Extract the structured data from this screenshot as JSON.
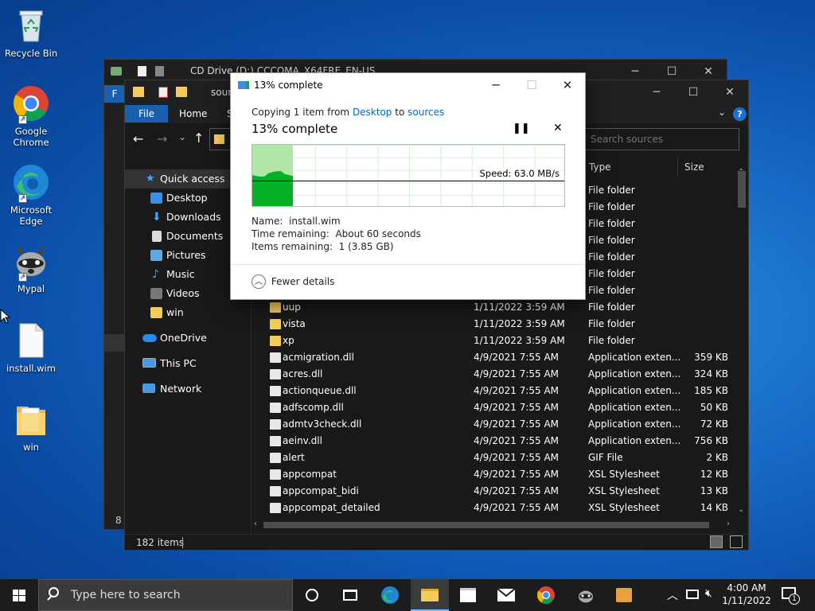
{
  "desktop": {
    "icons": [
      {
        "label": "Recycle Bin"
      },
      {
        "label": "Google Chrome"
      },
      {
        "label": "Microsoft Edge"
      },
      {
        "label": "Mypal"
      },
      {
        "label": "install.wim"
      },
      {
        "label": "win"
      }
    ]
  },
  "back_window": {
    "title": "CD Drive (D:) CCCOMA_X64FRE_EN-US_DV9",
    "status_fragment": "8 i",
    "ribbon_fragment": "F"
  },
  "explorer": {
    "path_fragment": "sour",
    "ribbon": {
      "file": "File",
      "home": "Home",
      "share_fragment": "S"
    },
    "search_placeholder": "Search sources",
    "columns": {
      "type": "Type",
      "size": "Size"
    },
    "nav": {
      "quick_access": "Quick access",
      "desktop": "Desktop",
      "downloads": "Downloads",
      "documents": "Documents",
      "pictures": "Pictures",
      "music": "Music",
      "videos": "Videos",
      "win": "win",
      "onedrive": "OneDrive",
      "thispc": "This PC",
      "network": "Network"
    },
    "partial_types": [
      "File folder",
      "File folder",
      "File folder",
      "File folder",
      "File folder",
      "File folder",
      "File folder"
    ],
    "files": [
      {
        "name": "uup",
        "date": "1/11/2022 3:59 AM",
        "type": "File folder",
        "size": "",
        "icon": "folder"
      },
      {
        "name": "vista",
        "date": "1/11/2022 3:59 AM",
        "type": "File folder",
        "size": "",
        "icon": "folder"
      },
      {
        "name": "xp",
        "date": "1/11/2022 3:59 AM",
        "type": "File folder",
        "size": "",
        "icon": "folder"
      },
      {
        "name": "acmigration.dll",
        "date": "4/9/2021 7:55 AM",
        "type": "Application exten...",
        "size": "359 KB",
        "icon": "dll"
      },
      {
        "name": "acres.dll",
        "date": "4/9/2021 7:55 AM",
        "type": "Application exten...",
        "size": "324 KB",
        "icon": "dll"
      },
      {
        "name": "actionqueue.dll",
        "date": "4/9/2021 7:55 AM",
        "type": "Application exten...",
        "size": "185 KB",
        "icon": "dll"
      },
      {
        "name": "adfscomp.dll",
        "date": "4/9/2021 7:55 AM",
        "type": "Application exten...",
        "size": "50 KB",
        "icon": "dll"
      },
      {
        "name": "admtv3check.dll",
        "date": "4/9/2021 7:55 AM",
        "type": "Application exten...",
        "size": "72 KB",
        "icon": "dll"
      },
      {
        "name": "aeinv.dll",
        "date": "4/9/2021 7:55 AM",
        "type": "Application exten...",
        "size": "756 KB",
        "icon": "dll"
      },
      {
        "name": "alert",
        "date": "4/9/2021 7:55 AM",
        "type": "GIF File",
        "size": "2 KB",
        "icon": "gif"
      },
      {
        "name": "appcompat",
        "date": "4/9/2021 7:55 AM",
        "type": "XSL Stylesheet",
        "size": "12 KB",
        "icon": "xsl"
      },
      {
        "name": "appcompat_bidi",
        "date": "4/9/2021 7:55 AM",
        "type": "XSL Stylesheet",
        "size": "13 KB",
        "icon": "xsl"
      },
      {
        "name": "appcompat_detailed",
        "date": "4/9/2021 7:55 AM",
        "type": "XSL Stylesheet",
        "size": "14 KB",
        "icon": "xsl"
      }
    ],
    "status": "182 items"
  },
  "copy_dialog": {
    "title": "13% complete",
    "copying_prefix": "Copying 1 item from ",
    "source": "Desktop",
    "to_word": " to ",
    "destination": "sources",
    "heading": "13% complete",
    "speed": "Speed: 63.0 MB/s",
    "progress_fraction": 0.13,
    "name_label": "Name:",
    "name_value": "install.wim",
    "time_label": "Time remaining:",
    "time_value": "About 60 seconds",
    "items_label": "Items remaining:",
    "items_value": "1 (3.85 GB)",
    "fewer_details": "Fewer details"
  },
  "taskbar": {
    "search_placeholder": "Type here to search",
    "time": "4:00 AM",
    "date": "1/11/2022",
    "notification_count": "1"
  },
  "colors": {
    "accent": "#0078d7",
    "progress_fill": "#06b025",
    "link": "#0066cc"
  }
}
